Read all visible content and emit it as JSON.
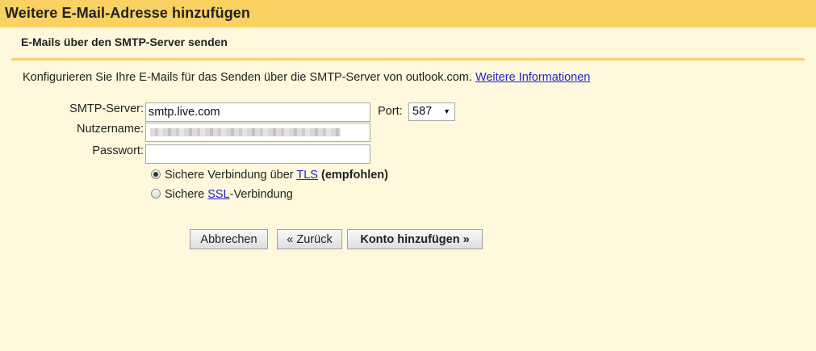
{
  "dialog": {
    "title": "Weitere E-Mail-Adresse hinzufügen",
    "subtitle": "E-Mails über den SMTP-Server senden",
    "intro_text": "Konfigurieren Sie Ihre E-Mails für das Senden über die SMTP-Server von outlook.com. ",
    "intro_link": "Weitere Informationen"
  },
  "form": {
    "smtp_label": "SMTP-Server:",
    "smtp_value": "smtp.live.com",
    "port_label": "Port:",
    "port_value": "587",
    "username_label": "Nutzername:",
    "password_label": "Passwort:"
  },
  "security": {
    "tls_prefix": "Sichere Verbindung über ",
    "tls_link": "TLS",
    "tls_suffix": " (empfohlen)",
    "tls_selected": true,
    "ssl_prefix": "Sichere ",
    "ssl_link": "SSL",
    "ssl_suffix": "-Verbindung"
  },
  "buttons": {
    "cancel": "Abbrechen",
    "back": "« Zurück",
    "add": "Konto hinzufügen »"
  }
}
